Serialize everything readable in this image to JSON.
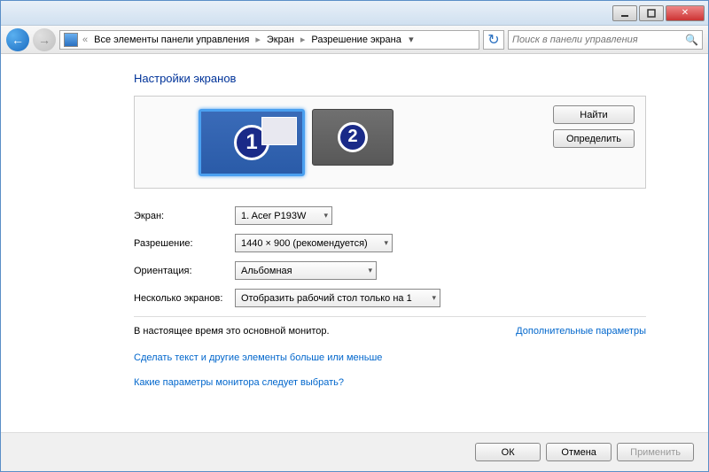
{
  "breadcrumb": {
    "item1": "Все элементы панели управления",
    "item2": "Экран",
    "item3": "Разрешение экрана"
  },
  "search": {
    "placeholder": "Поиск в панели управления"
  },
  "page": {
    "title": "Настройки экранов"
  },
  "preview": {
    "monitor1_num": "1",
    "monitor2_num": "2",
    "find_btn": "Найти",
    "identify_btn": "Определить"
  },
  "form": {
    "display_label": "Экран:",
    "display_value": "1. Acer P193W",
    "resolution_label": "Разрешение:",
    "resolution_value": "1440 × 900 (рекомендуется)",
    "orientation_label": "Ориентация:",
    "orientation_value": "Альбомная",
    "multiple_label": "Несколько экранов:",
    "multiple_value": "Отобразить рабочий стол только на 1"
  },
  "status": {
    "main_monitor": "В настоящее время это основной монитор.",
    "advanced_link": "Дополнительные параметры"
  },
  "links": {
    "text_size": "Сделать текст и другие элементы больше или меньше",
    "which_settings": "Какие параметры монитора следует выбрать?"
  },
  "footer": {
    "ok": "ОК",
    "cancel": "Отмена",
    "apply": "Применить"
  }
}
